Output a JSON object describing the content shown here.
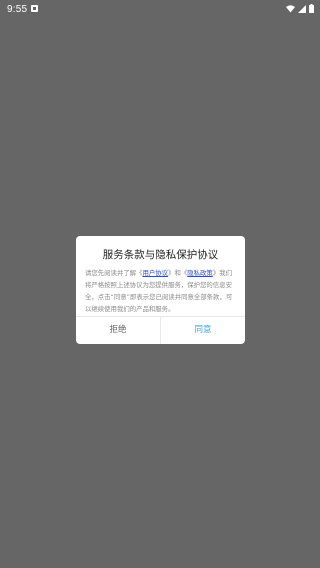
{
  "status_bar": {
    "time": "9:55",
    "icons": [
      "notification-icon",
      "wifi-icon",
      "signal-icon",
      "battery-icon"
    ]
  },
  "dialog": {
    "title": "服务条款与隐私保护协议",
    "body_intro": "请您先阅读并了解《",
    "link_user_agreement": "用户协议",
    "body_and": "》和《",
    "link_privacy_policy": "隐私政策",
    "body_rest": "》我们将严格按照上述协议为您提供服务，保护您的信息安全，点击“同意”即表示您已阅读并同意全部条款，可以继续使用我们的产品和服务。",
    "refuse_label": "拒绝",
    "agree_label": "同意"
  },
  "colors": {
    "overlay": "#666666",
    "link": "#2a4bd6",
    "agree": "#35a6e6"
  }
}
